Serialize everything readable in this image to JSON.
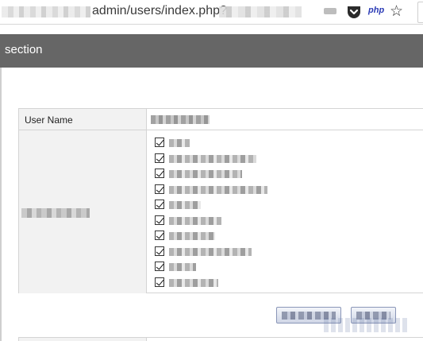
{
  "browser": {
    "url_visible_text": "admin/users/index.php?",
    "extension_php_label": "php",
    "icons": [
      "pocket-icon",
      "php-extension-icon",
      "star-icon"
    ],
    "accent": "#d70022"
  },
  "section": {
    "title": "section",
    "bar_color": "#666666"
  },
  "form": {
    "username_label": "User Name",
    "permissions_count": 10,
    "permissions_all_checked": true
  },
  "buttons": {
    "count": 2,
    "color": "#cfd6e6"
  }
}
